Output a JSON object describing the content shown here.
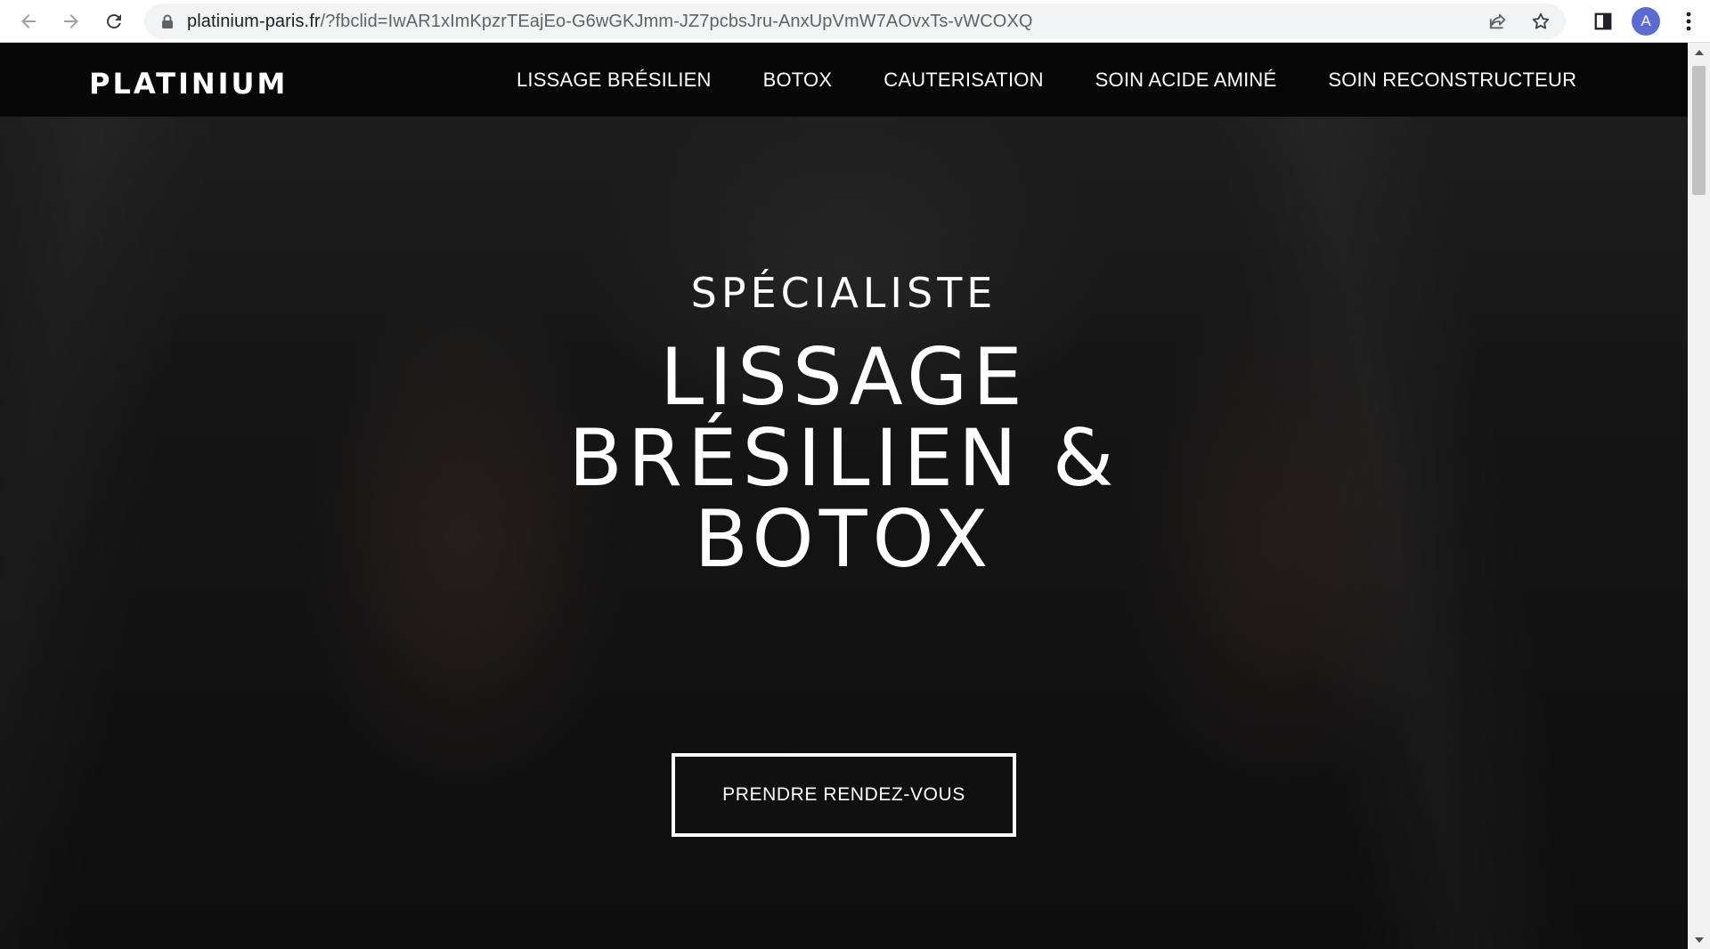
{
  "browser": {
    "url_host": "platinium-paris.fr",
    "url_rest": "/?fbclid=IwAR1xImKpzrTEajEo-G6wGKJmm-JZ7pcbsJru-AnxUpVmW7AOvxTs-vWCOXQ",
    "profile_initial": "A",
    "icons": [
      "back-arrow-icon",
      "forward-arrow-icon",
      "reload-icon",
      "lock-icon",
      "share-icon",
      "star-icon",
      "side-panel-icon",
      "kebab-menu-icon"
    ]
  },
  "site": {
    "logo": "PLATINIUM",
    "menu": [
      {
        "label": "LISSAGE BRÉSILIEN"
      },
      {
        "label": "BOTOX"
      },
      {
        "label": "CAUTERISATION"
      },
      {
        "label": "SOIN ACIDE AMINÉ"
      },
      {
        "label": "SOIN RECONSTRUCTEUR"
      }
    ]
  },
  "hero": {
    "kicker": "SPÉCIALISTE",
    "headline": "LISSAGE BRÉSILIEN & BOTOX",
    "cta": "PRENDRE RENDEZ-VOUS"
  },
  "colors": {
    "header_bg": "#070707",
    "text": "#ffffff",
    "avatar": "#5b6bd3",
    "logo_accent": "#7b4fd1"
  }
}
